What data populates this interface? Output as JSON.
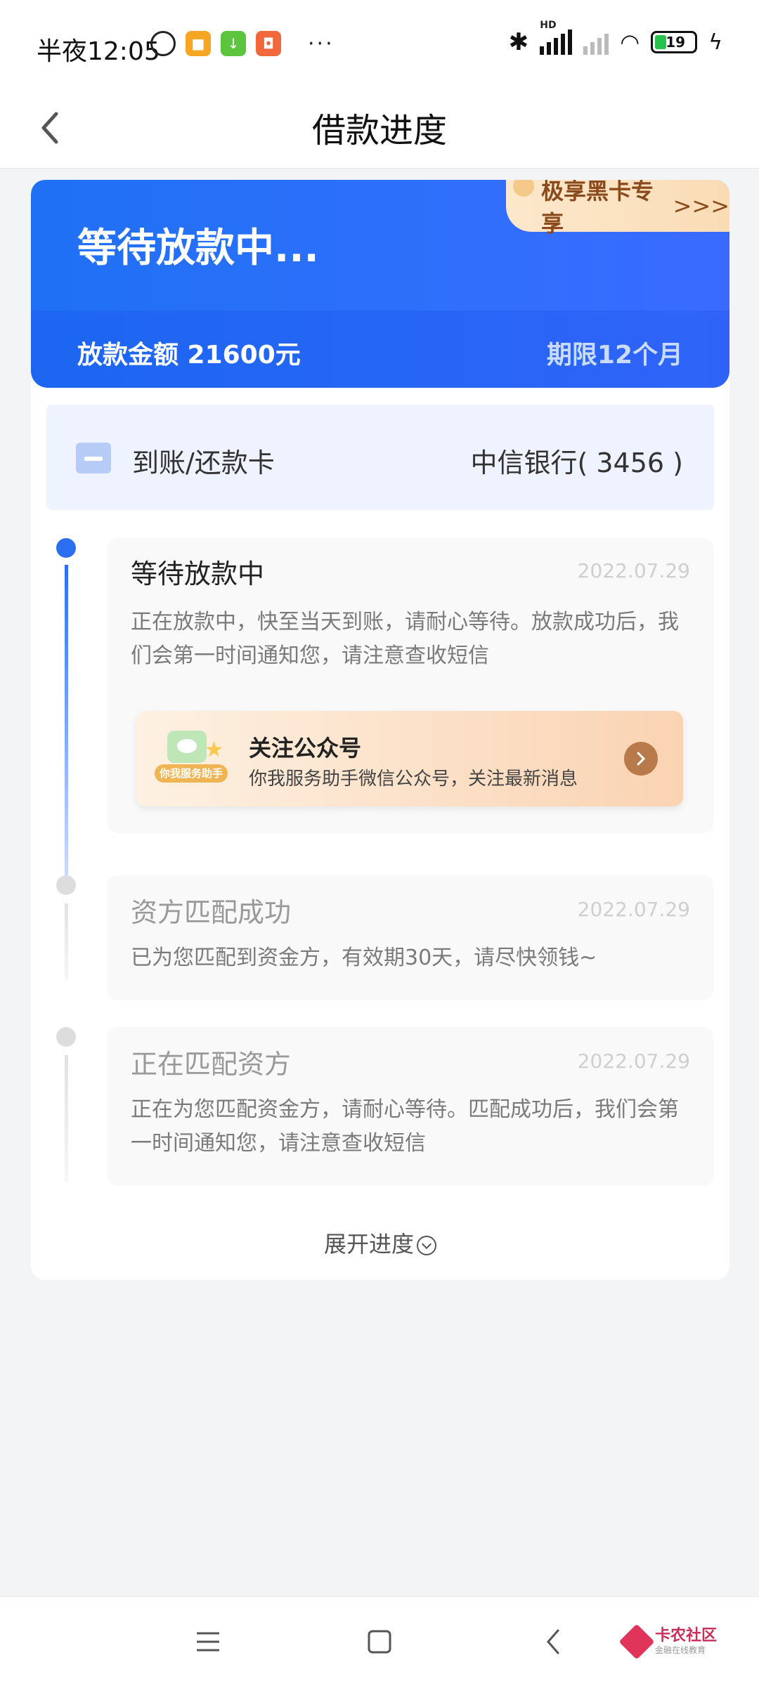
{
  "status_bar": {
    "time": "半夜12:05",
    "battery": "19",
    "more": "···",
    "hd": "HD"
  },
  "header": {
    "title": "借款进度"
  },
  "hero": {
    "status": "等待放款中...",
    "amount": "放款金额 21600元",
    "term": "期限12个月",
    "vip_label": "极享黑卡专享",
    "vip_arrows": ">>>"
  },
  "card": {
    "label": "到账/还款卡",
    "value": "中信银行( 3456 )"
  },
  "steps": [
    {
      "title": "等待放款中",
      "date": "2022.07.29",
      "desc": "正在放款中，快至当天到账，请耐心等待。放款成功后，我们会第一时间通知您，请注意查收短信"
    },
    {
      "title": "资方匹配成功",
      "date": "2022.07.29",
      "desc": "已为您匹配到资金方，有效期30天，请尽快领钱~"
    },
    {
      "title": "正在匹配资方",
      "date": "2022.07.29",
      "desc": "正在为您匹配资金方，请耐心等待。匹配成功后，我们会第一时间通知您，请注意查收短信"
    }
  ],
  "promo": {
    "badge": "你我服务助手",
    "title": "关注公众号",
    "subtitle": "你我服务助手微信公众号，关注最新消息"
  },
  "expand": {
    "label": "展开进度"
  },
  "watermark": {
    "main": "卡农社区",
    "sub": "金融在线教育"
  },
  "colors": {
    "primary": "#1f70f5",
    "timeline_active": "#2b6ff0",
    "timeline_inactive": "#dddddd"
  }
}
